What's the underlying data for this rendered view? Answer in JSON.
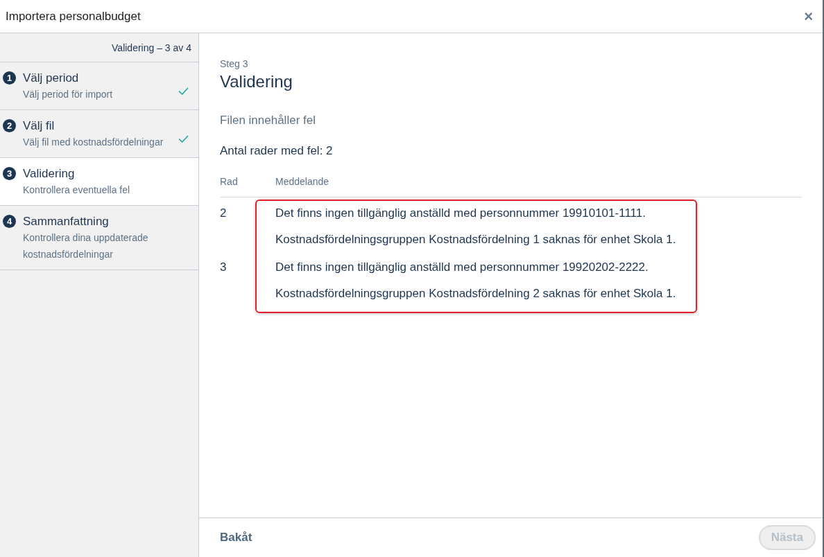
{
  "window": {
    "title": "Importera personalbudget",
    "close": "×"
  },
  "sidebar": {
    "progress": "Validering – 3 av 4",
    "steps": [
      {
        "number": "1",
        "title": "Välj period",
        "description": "Välj period för import",
        "done": true,
        "selected": false
      },
      {
        "number": "2",
        "title": "Välj fil",
        "description": "Välj fil med kostnadsfördelningar",
        "done": true,
        "selected": false
      },
      {
        "number": "3",
        "title": "Validering",
        "description": "Kontrollera eventuella fel",
        "done": false,
        "selected": true
      },
      {
        "number": "4",
        "title": "Sammanfattning",
        "description": "Kontrollera dina uppdaterade kostnadsfördelningar",
        "done": false,
        "selected": false
      }
    ]
  },
  "main": {
    "step_label": "Steg 3",
    "heading": "Validering",
    "status": "Filen innehåller fel",
    "error_count": "Antal rader med fel: 2",
    "table": {
      "columns": [
        "Rad",
        "Meddelande"
      ],
      "rows": [
        {
          "row": "2",
          "messages": [
            "Det finns ingen tillgänglig anställd med personnummer 19910101-1111.",
            "Kostnadsfördelningsgruppen Kostnadsfördelning 1 saknas för enhet Skola 1."
          ]
        },
        {
          "row": "3",
          "messages": [
            "Det finns ingen tillgänglig anställd med personnummer 19920202-2222.",
            "Kostnadsfördelningsgruppen Kostnadsfördelning 2 saknas för enhet Skola 1."
          ]
        }
      ]
    }
  },
  "footer": {
    "back": {
      "label": "Bakåt",
      "disabled": false
    },
    "next": {
      "label": "Nästa",
      "disabled": true
    }
  }
}
